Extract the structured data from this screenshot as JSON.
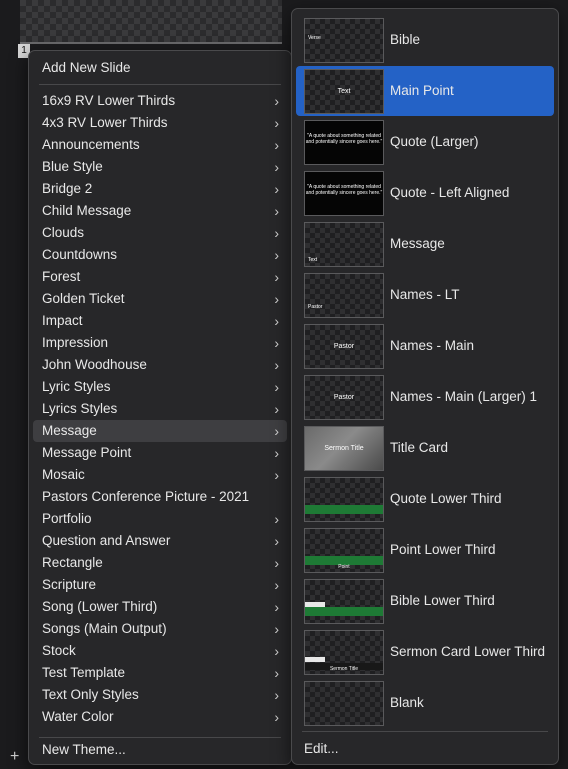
{
  "background": {
    "thumb_number": "1",
    "add_button": "+"
  },
  "menu": {
    "add_new_slide": "Add New Slide",
    "items": [
      {
        "label": "16x9 RV Lower Thirds",
        "has_submenu": true
      },
      {
        "label": "4x3 RV Lower Thirds",
        "has_submenu": true
      },
      {
        "label": "Announcements",
        "has_submenu": true
      },
      {
        "label": "Blue Style",
        "has_submenu": true
      },
      {
        "label": "Bridge 2",
        "has_submenu": true
      },
      {
        "label": "Child Message",
        "has_submenu": true
      },
      {
        "label": "Clouds",
        "has_submenu": true
      },
      {
        "label": "Countdowns",
        "has_submenu": true
      },
      {
        "label": "Forest",
        "has_submenu": true
      },
      {
        "label": "Golden Ticket",
        "has_submenu": true
      },
      {
        "label": "Impact",
        "has_submenu": true
      },
      {
        "label": "Impression",
        "has_submenu": true
      },
      {
        "label": "John Woodhouse",
        "has_submenu": true
      },
      {
        "label": "Lyric Styles",
        "has_submenu": true
      },
      {
        "label": "Lyrics Styles",
        "has_submenu": true
      },
      {
        "label": "Message",
        "has_submenu": true,
        "highlighted": true
      },
      {
        "label": "Message Point",
        "has_submenu": true
      },
      {
        "label": "Mosaic",
        "has_submenu": true
      },
      {
        "label": "Pastors Conference Picture - 2021",
        "has_submenu": false
      },
      {
        "label": "Portfolio",
        "has_submenu": true
      },
      {
        "label": "Question and Answer",
        "has_submenu": true
      },
      {
        "label": "Rectangle",
        "has_submenu": true
      },
      {
        "label": "Scripture",
        "has_submenu": true
      },
      {
        "label": "Song (Lower Third)",
        "has_submenu": true
      },
      {
        "label": "Songs (Main Output)",
        "has_submenu": true
      },
      {
        "label": "Stock",
        "has_submenu": true
      },
      {
        "label": "Test Template",
        "has_submenu": true
      },
      {
        "label": "Text Only Styles",
        "has_submenu": true
      },
      {
        "label": "Water Color",
        "has_submenu": true
      }
    ],
    "new_theme": "New Theme...",
    "chevron": "›"
  },
  "submenu": {
    "items": [
      {
        "label": "Bible",
        "thumb": "checker",
        "thumb_text": "Verse"
      },
      {
        "label": "Main Point",
        "thumb": "checker",
        "thumb_text": "Text",
        "selected": true
      },
      {
        "label": "Quote (Larger)",
        "thumb": "dark",
        "thumb_text": "\"A quote about something related and potentially sincere goes here.\""
      },
      {
        "label": "Quote - Left Aligned",
        "thumb": "dark",
        "thumb_text": "\"A quote about something related and potentially sincere goes here.\""
      },
      {
        "label": "Message",
        "thumb": "checker",
        "thumb_text": "Text"
      },
      {
        "label": "Names - LT",
        "thumb": "checker",
        "thumb_text": "Pastor"
      },
      {
        "label": "Names - Main",
        "thumb": "checker",
        "thumb_text": "Pastor"
      },
      {
        "label": "Names - Main (Larger) 1",
        "thumb": "checker",
        "thumb_text": "Pastor"
      },
      {
        "label": "Title Card",
        "thumb": "gray",
        "thumb_text": "Sermon Title"
      },
      {
        "label": "Quote Lower Third",
        "thumb": "green-bar",
        "thumb_text": ""
      },
      {
        "label": "Point Lower Third",
        "thumb": "green-bar",
        "thumb_text": "Point"
      },
      {
        "label": "Bible Lower Third",
        "thumb": "green-white-bar",
        "thumb_text": ""
      },
      {
        "label": "Sermon Card Lower Third",
        "thumb": "dark-bar",
        "thumb_text": "Sermon Title"
      },
      {
        "label": "Blank",
        "thumb": "checker",
        "thumb_text": ""
      }
    ],
    "edit": "Edit..."
  },
  "colors": {
    "selection": "#2462c6",
    "menu_bg": "#272729",
    "highlight": "#3e3e41",
    "green_bar": "#1e7a35"
  }
}
